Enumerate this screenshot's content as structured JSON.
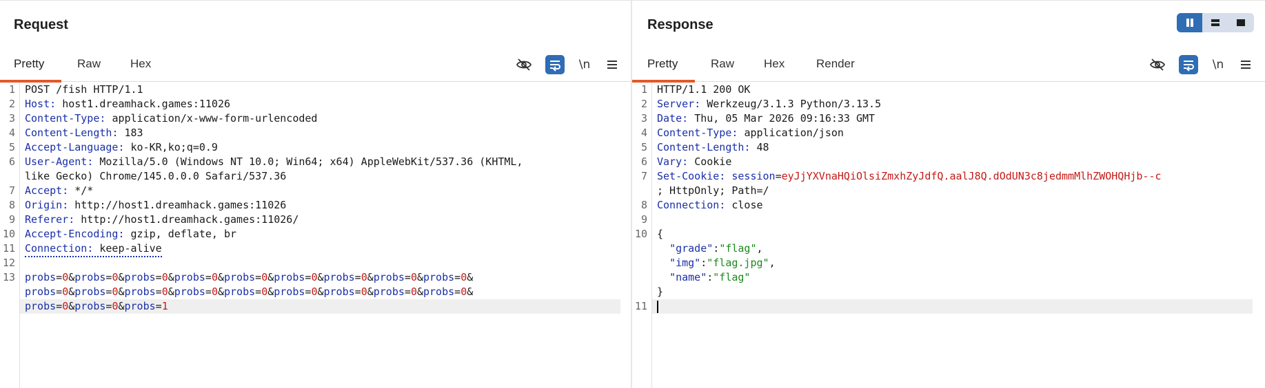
{
  "request": {
    "title": "Request",
    "tabs": [
      "Pretty",
      "Raw",
      "Hex"
    ],
    "toolbar": {
      "newline_label": "\\n"
    },
    "lines": [
      {
        "num": "1",
        "method": "POST /fish HTTP/1.1"
      },
      {
        "num": "2",
        "key": "Host",
        "value": "host1.dreamhack.games:11026"
      },
      {
        "num": "3",
        "key": "Content-Type",
        "value": "application/x-www-form-urlencoded"
      },
      {
        "num": "4",
        "key": "Content-Length",
        "value": "183"
      },
      {
        "num": "5",
        "key": "Accept-Language",
        "value": "ko-KR,ko;q=0.9"
      },
      {
        "num": "6",
        "key": "User-Agent",
        "value": "Mozilla/5.0 (Windows NT 10.0; Win64; x64) AppleWebKit/537.36 (KHTML,",
        "value2": "like Gecko) Chrome/145.0.0.0 Safari/537.36"
      },
      {
        "num": "7",
        "key": "Accept",
        "value": "*/*"
      },
      {
        "num": "8",
        "key": "Origin",
        "value": "http://host1.dreamhack.games:11026"
      },
      {
        "num": "9",
        "key": "Referer",
        "value": "http://host1.dreamhack.games:11026/"
      },
      {
        "num": "10",
        "key": "Accept-Encoding",
        "value": "gzip, deflate, br"
      },
      {
        "num": "11",
        "key": "Connection",
        "value": "keep-alive"
      },
      {
        "num": "12"
      },
      {
        "num": "13"
      }
    ],
    "body": {
      "param_name": "probs",
      "rows": [
        [
          "0",
          "0",
          "0",
          "0",
          "0",
          "0",
          "0",
          "0",
          "0"
        ],
        [
          "0",
          "0",
          "0",
          "0",
          "0",
          "0",
          "0",
          "0",
          "0"
        ],
        [
          "0",
          "0",
          "1"
        ]
      ]
    }
  },
  "response": {
    "title": "Response",
    "tabs": [
      "Pretty",
      "Raw",
      "Hex",
      "Render"
    ],
    "toolbar": {
      "newline_label": "\\n"
    },
    "lines": [
      {
        "num": "1",
        "status": "HTTP/1.1 200 OK"
      },
      {
        "num": "2",
        "key": "Server",
        "value": "Werkzeug/3.1.3 Python/3.13.5"
      },
      {
        "num": "3",
        "key": "Date",
        "value": "Thu, 05 Mar 2026 09:16:33 GMT"
      },
      {
        "num": "4",
        "key": "Content-Type",
        "value": "application/json"
      },
      {
        "num": "5",
        "key": "Content-Length",
        "value": "48"
      },
      {
        "num": "6",
        "key": "Vary",
        "value": "Cookie"
      },
      {
        "num": "7",
        "key": "Set-Cookie",
        "cookie_name": "session",
        "cookie_value": "eyJjYXVnaHQiOlsiZmxhZyJdfQ.aalJ8Q.dOdUN3c8jedmmMlhZWOHQHjb--c",
        "cookie_tail": "; HttpOnly; Path=/"
      },
      {
        "num": "8",
        "key": "Connection",
        "value": "close"
      },
      {
        "num": "9"
      },
      {
        "num": "10"
      },
      {
        "num": "11"
      }
    ],
    "json": {
      "open": "{",
      "close": "}",
      "fields": [
        {
          "key": "\"grade\"",
          "value": "\"flag\"",
          "sep": ","
        },
        {
          "key": "\"img\"",
          "value": "\"flag.jpg\"",
          "sep": ","
        },
        {
          "key": "\"name\"",
          "value": "\"flag\"",
          "sep": ""
        }
      ]
    }
  },
  "colors": {
    "accent": "#e05a2b",
    "toggle_active": "#2f6db5",
    "header_key": "#1a2fa8",
    "param_value": "#c41a16",
    "json_string": "#1a8a1a"
  }
}
